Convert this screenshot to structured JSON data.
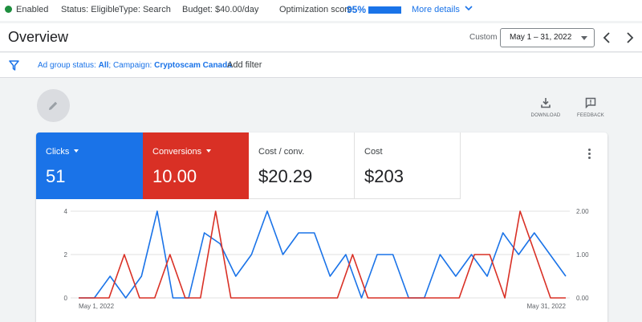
{
  "statusbar": {
    "enabled": "Enabled",
    "status": "Status: Eligible",
    "type": "Type: Search",
    "budget": "Budget: $40.00/day",
    "optimization_label": "Optimization score:",
    "optimization_value": "95%",
    "optimization_fraction": 0.95,
    "more_details": "More details"
  },
  "header": {
    "title": "Overview",
    "range_label": "Custom",
    "date_range": "May 1 – 31, 2022"
  },
  "filters": {
    "ad_group_key": "Ad group status: ",
    "ad_group_value": "All",
    "campaign_key": "; Campaign: ",
    "campaign_value": "Cryptoscam Canada",
    "add_filter": "Add filter"
  },
  "tools": {
    "download": "DOWNLOAD",
    "feedback": "FEEDBACK"
  },
  "metrics": {
    "clicks_label": "Clicks",
    "clicks_value": "51",
    "conversions_label": "Conversions",
    "conversions_value": "10.00",
    "cost_per_conv_label": "Cost / conv.",
    "cost_per_conv_value": "$20.29",
    "cost_label": "Cost",
    "cost_value": "$203"
  },
  "colors": {
    "clicks": "#1a73e8",
    "conversions": "#d93025",
    "enabled": "#1e8e3e"
  },
  "chart_data": {
    "type": "line",
    "x_start_label": "May 1, 2022",
    "x_end_label": "May 31, 2022",
    "left_axis": {
      "ticks": [
        "0",
        "2",
        "4"
      ],
      "ylim": [
        0,
        4
      ]
    },
    "right_axis": {
      "ticks": [
        "0.00",
        "1.00",
        "2.00"
      ],
      "ylim": [
        0,
        2
      ]
    },
    "series": [
      {
        "name": "Clicks",
        "axis": "left",
        "color": "#1a73e8",
        "values": [
          0,
          0,
          1,
          0,
          1,
          4,
          0,
          0,
          3,
          2.5,
          1,
          2,
          4,
          2,
          3,
          3,
          1,
          2,
          0,
          2,
          2,
          0,
          0,
          2,
          1,
          2,
          1,
          3,
          2,
          3,
          2,
          1
        ]
      },
      {
        "name": "Conversions",
        "axis": "right",
        "color": "#d93025",
        "values": [
          0,
          0,
          0,
          1,
          0,
          0,
          1,
          0,
          0,
          2,
          0,
          0,
          0,
          0,
          0,
          0,
          0,
          0,
          1,
          0,
          0,
          0,
          0,
          0,
          0,
          0,
          1,
          1,
          0,
          2,
          1,
          0,
          0
        ]
      }
    ],
    "grid": true
  }
}
